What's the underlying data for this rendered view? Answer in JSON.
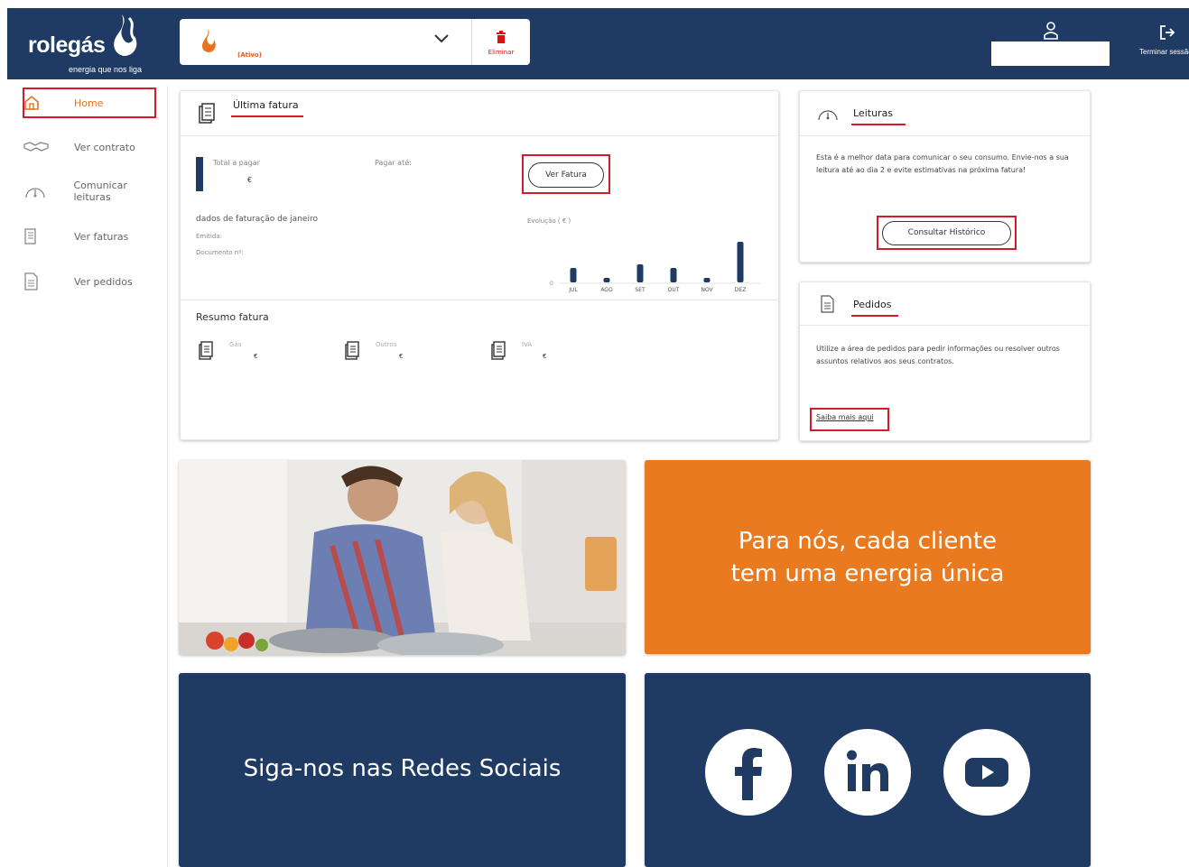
{
  "brand": {
    "name": "rolegás",
    "tagline": "energia que nos liga",
    "accent": "#e6731e",
    "navy": "#1f3b63",
    "alert": "#d41b2c"
  },
  "header": {
    "contract_status": "(Ativo)",
    "delete_label": "Eliminar",
    "logout_label": "Terminar sessão"
  },
  "sidebar": {
    "items": [
      {
        "label": "Home",
        "icon": "home-icon",
        "active": true
      },
      {
        "label": "Ver contrato",
        "icon": "handshake-icon"
      },
      {
        "label": "Comunicar leituras",
        "icon": "gauge-icon"
      },
      {
        "label": "Ver faturas",
        "icon": "invoice-icon"
      },
      {
        "label": "Ver pedidos",
        "icon": "requests-icon"
      }
    ]
  },
  "invoice": {
    "title": "Última fatura",
    "total_label": "Total a pagar",
    "total_currency": "€",
    "due_label": "Pagar até:",
    "view_button": "Ver Fatura",
    "billing_label": "dados de faturação de janeiro",
    "issued_label": "Emitida:",
    "document_label": "Documento nº:",
    "evolution_label": "Evolução ( € )",
    "summary_title": "Resumo fatura",
    "summary": [
      {
        "label": "Gás",
        "currency": "€"
      },
      {
        "label": "Outros",
        "currency": "€"
      },
      {
        "label": "IVA",
        "currency": "€"
      }
    ]
  },
  "chart_data": {
    "type": "bar",
    "categories": [
      "JUL",
      "AGO",
      "SET",
      "OUT",
      "NOV",
      "DEZ"
    ],
    "values": [
      16,
      5,
      20,
      16,
      5,
      45
    ],
    "ylim": [
      0,
      50
    ],
    "ytick_label": "0",
    "color": "#1f3b63"
  },
  "readings": {
    "title": "Leituras",
    "text": "Esta é a melhor data para comunicar o seu consumo. Envie-nos a sua leitura até ao dia 2 e evite estimativas na próxima fatura!",
    "button": "Consultar Histórico"
  },
  "requests": {
    "title": "Pedidos",
    "text": "Utilize a área de pedidos para pedir informações ou resolver outros assuntos relativos aos seus contratos.",
    "link": "Saiba mais aqui"
  },
  "promo": {
    "slogan_line1": "Para nós, cada cliente",
    "slogan_line2": "tem uma energia única",
    "social_title": "Siga-nos nas Redes Sociais",
    "social_icons": [
      "facebook-icon",
      "linkedin-icon",
      "youtube-icon"
    ],
    "orange": "#e97a1f"
  }
}
